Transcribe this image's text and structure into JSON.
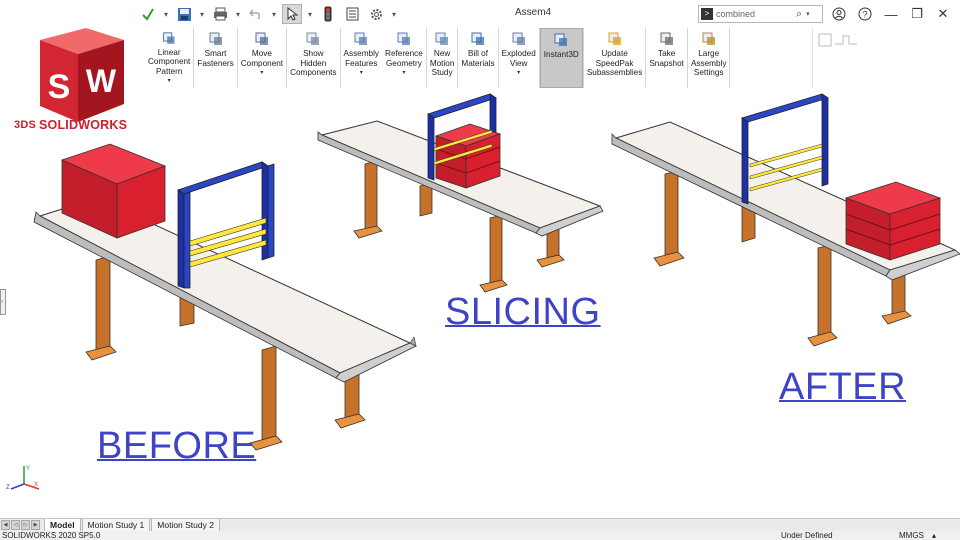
{
  "window": {
    "document_title": "Assem4"
  },
  "quick_access": [
    {
      "icon": "rebuild-icon"
    },
    {
      "icon": "save-icon"
    },
    {
      "icon": "print-icon"
    },
    {
      "icon": "undo-icon"
    },
    {
      "icon": "select-pointer-icon"
    },
    {
      "icon": "traffic-light-icon"
    },
    {
      "icon": "file-properties-icon"
    },
    {
      "icon": "options-gear-icon"
    }
  ],
  "search": {
    "value": "combined"
  },
  "toolbar": {
    "tools": [
      {
        "label": "Linear\nComponent\nPattern",
        "icon": "linear-pattern-icon",
        "has_menu": true
      },
      {
        "label": "Smart\nFasteners",
        "icon": "smart-fasteners-icon",
        "has_menu": false
      },
      {
        "label": "Move\nComponent",
        "icon": "move-component-icon",
        "has_menu": true
      },
      {
        "label": "Show\nHidden\nComponents",
        "icon": "show-hidden-icon",
        "has_menu": false
      },
      {
        "label": "Assembly\nFeatures",
        "icon": "assembly-features-icon",
        "has_menu": true
      },
      {
        "label": "Reference\nGeometry",
        "icon": "reference-geometry-icon",
        "has_menu": true
      },
      {
        "label": "New\nMotion\nStudy",
        "icon": "motion-study-icon",
        "has_menu": false
      },
      {
        "label": "Bill of\nMaterials",
        "icon": "bill-of-materials-icon",
        "has_menu": false
      },
      {
        "label": "Exploded\nView",
        "icon": "exploded-view-icon",
        "has_menu": true
      },
      {
        "label": "Instant3D",
        "icon": "instant3d-icon",
        "has_menu": false,
        "active": true
      },
      {
        "label": "Update\nSpeedPak\nSubassemblies",
        "icon": "speedpak-icon",
        "has_menu": false
      },
      {
        "label": "Take\nSnapshot",
        "icon": "snapshot-icon",
        "has_menu": false
      },
      {
        "label": "Large\nAssembly\nSettings",
        "icon": "large-assembly-icon",
        "has_menu": false
      }
    ]
  },
  "logo": {
    "badge": "SW",
    "brand": "SOLIDWORKS",
    "ds": "3DS"
  },
  "captions": {
    "before": "BEFORE",
    "slicing": "SLICING",
    "after": "AFTER"
  },
  "tabs": [
    {
      "label": "Model",
      "active": true
    },
    {
      "label": "Motion Study 1",
      "active": false
    },
    {
      "label": "Motion Study 2",
      "active": false
    }
  ],
  "status": {
    "version": "SOLIDWORKS 2020 SP5.0",
    "state": "Under Defined",
    "units": "MMGS"
  },
  "colors": {
    "caption": "#3e43c7",
    "block_red": "#d8202f",
    "frame_blue": "#1c2fa8",
    "blade_yellow": "#ffe839",
    "leg_orange": "#c7722a",
    "belt": "#f4f1ec",
    "brand_red": "#cf1f2a"
  }
}
